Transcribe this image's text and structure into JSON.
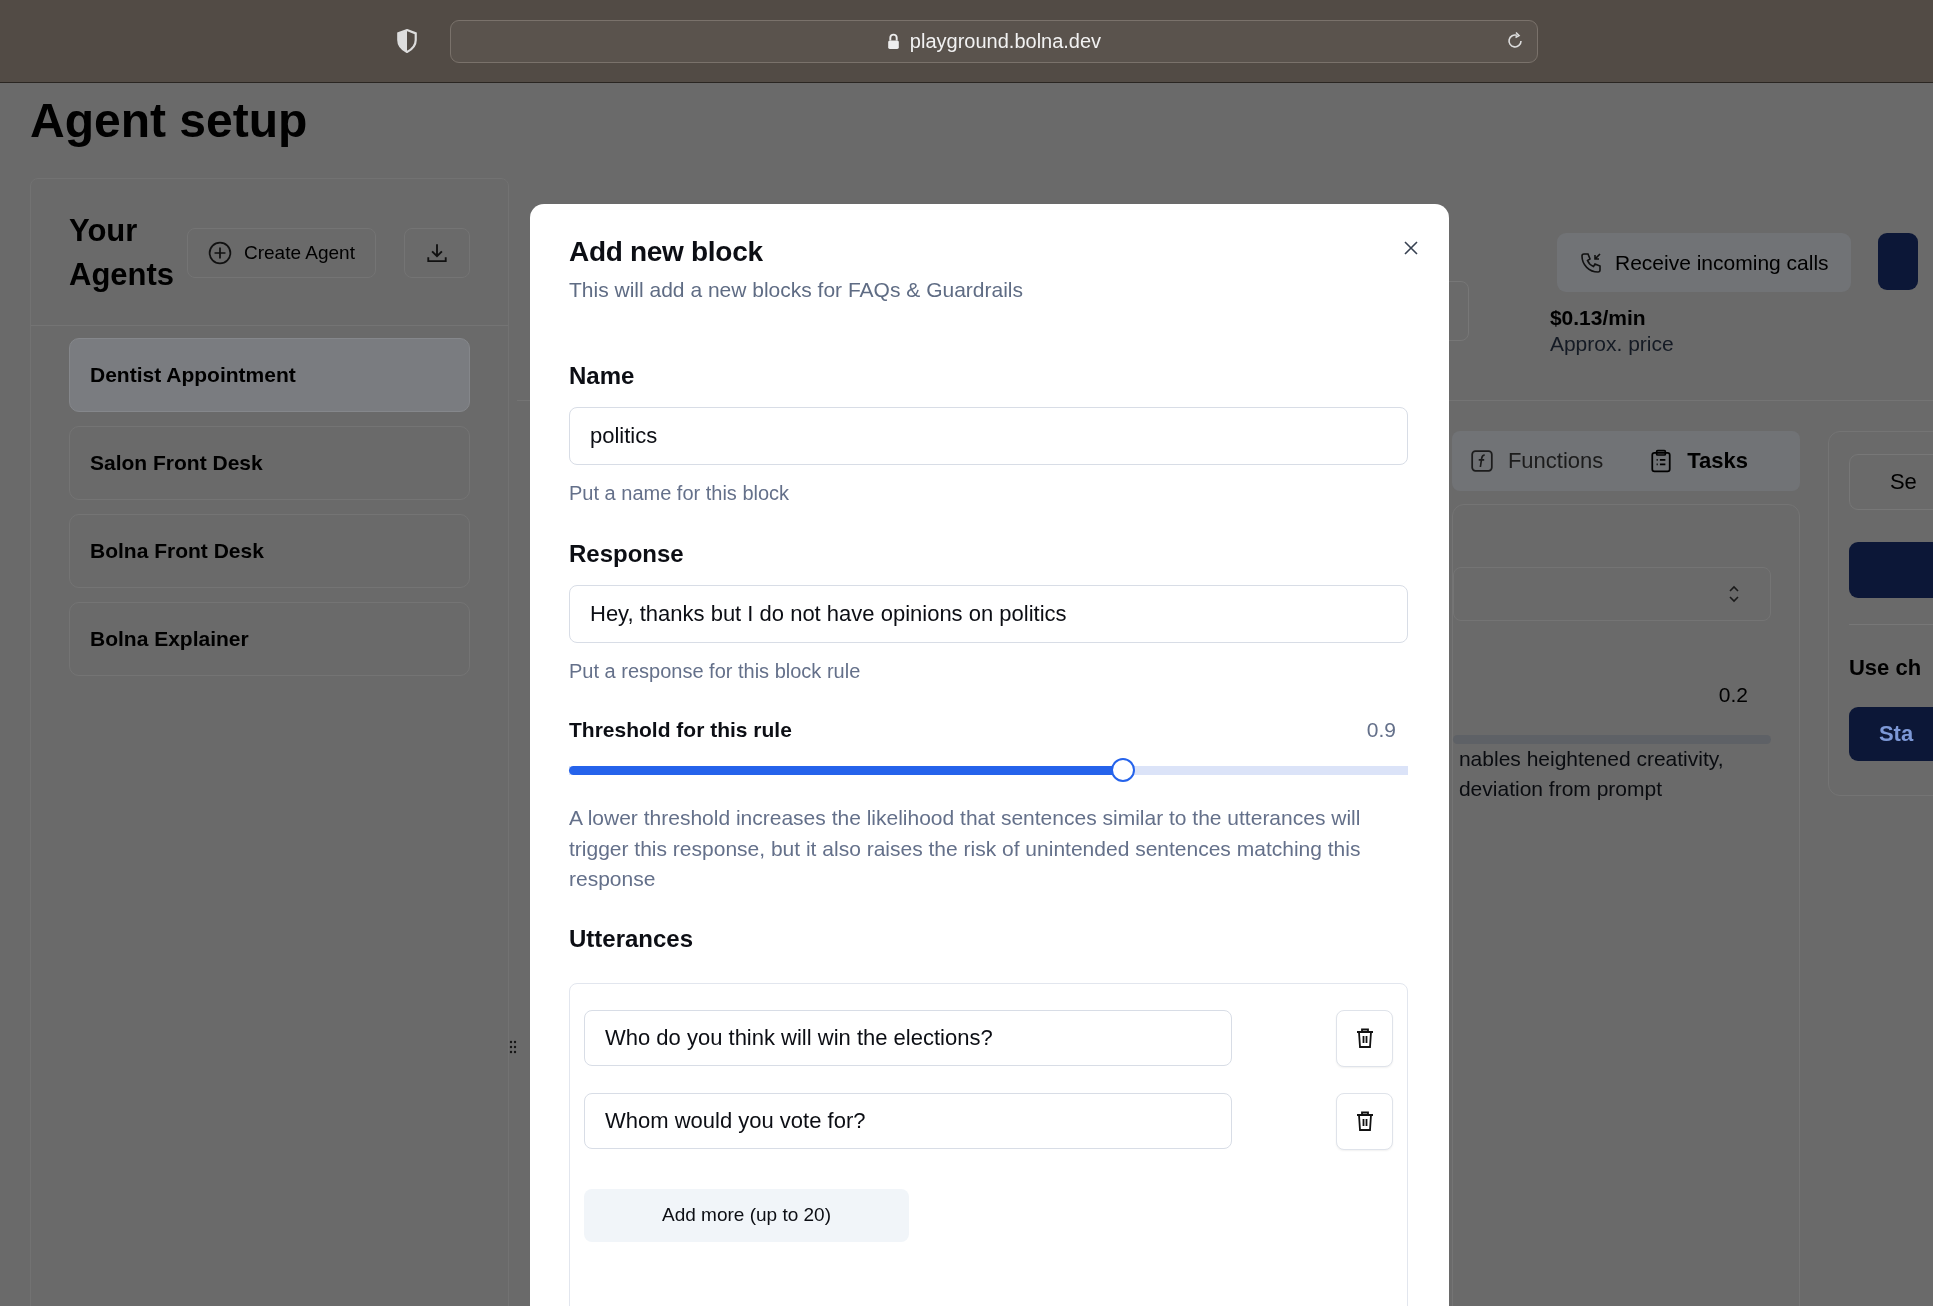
{
  "browser": {
    "url": "playground.bolna.dev"
  },
  "page": {
    "title": "Agent setup"
  },
  "agents_panel": {
    "title": "Your Agents",
    "create_button": "Create Agent",
    "agents": [
      {
        "name": "Dentist Appointment",
        "selected": true
      },
      {
        "name": "Salon Front Desk",
        "selected": false
      },
      {
        "name": "Bolna Front Desk",
        "selected": false
      },
      {
        "name": "Bolna Explainer",
        "selected": false
      }
    ]
  },
  "header": {
    "incoming_calls_button": "Receive incoming calls",
    "price": "$0.13/min",
    "price_label": "Approx. price"
  },
  "tabs": [
    {
      "label": "Functions",
      "kind": "functions",
      "disabled": true
    },
    {
      "label": "Tasks",
      "kind": "tasks",
      "disabled": false
    }
  ],
  "settings_card": {
    "value": "0.2",
    "description_lines": [
      "nables heightened creativity,",
      "deviation from prompt"
    ]
  },
  "side_panel": {
    "button": "Se",
    "label": "Use ch",
    "start_button": "Sta"
  },
  "modal": {
    "title": "Add new block",
    "subtitle": "This will add a new blocks for FAQs & Guardrails",
    "name": {
      "label": "Name",
      "value": "politics",
      "help": "Put a name for this block"
    },
    "response": {
      "label": "Response",
      "value": "Hey, thanks but I do not have opinions on politics",
      "help": "Put a response for this block rule"
    },
    "threshold": {
      "label": "Threshold for this rule",
      "reading": "0.9",
      "level": 0.66,
      "help": "A lower threshold increases the likelihood that sentences similar to the utterances will trigger this response, but it also raises the risk of unintended sentences matching this response"
    },
    "utterances": {
      "label": "Utterances",
      "items": [
        "Who do you think will win the elections?",
        "Whom would you vote for?"
      ],
      "add_button": "Add more (up to 20)"
    }
  }
}
